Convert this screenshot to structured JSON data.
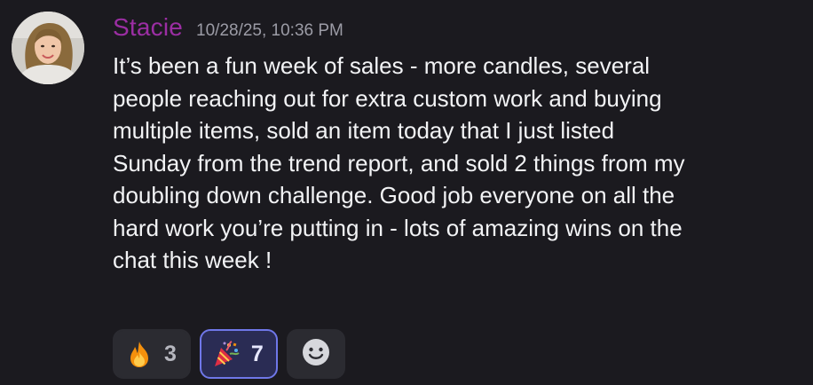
{
  "message": {
    "author": "Stacie",
    "timestamp": "10/28/25, 10:36 PM",
    "content": "It’s been a fun week of sales - more candles, several\npeople reaching out for extra custom work and buying\nmultiple items, sold an item today that I just listed\nSunday from the trend report, and sold 2 things from my\ndoubling down challenge. Good job everyone on all the\nhard work you’re putting in - lots of amazing wins on the\nchat this week !"
  },
  "reactions": [
    {
      "emoji": "fire-icon",
      "count": "3",
      "active": false
    },
    {
      "emoji": "party-popper-icon",
      "count": "7",
      "active": true
    }
  ],
  "add_reaction": {
    "icon": "smiley-icon"
  },
  "colors": {
    "background": "#1b1a1f",
    "author": "#9b2ea3",
    "timestamp": "#9c9ca6",
    "text": "#f2f3f5",
    "reaction_bg": "#2b2b31",
    "reaction_active_bg": "#2a2c54",
    "reaction_active_border": "#6f77e8"
  }
}
